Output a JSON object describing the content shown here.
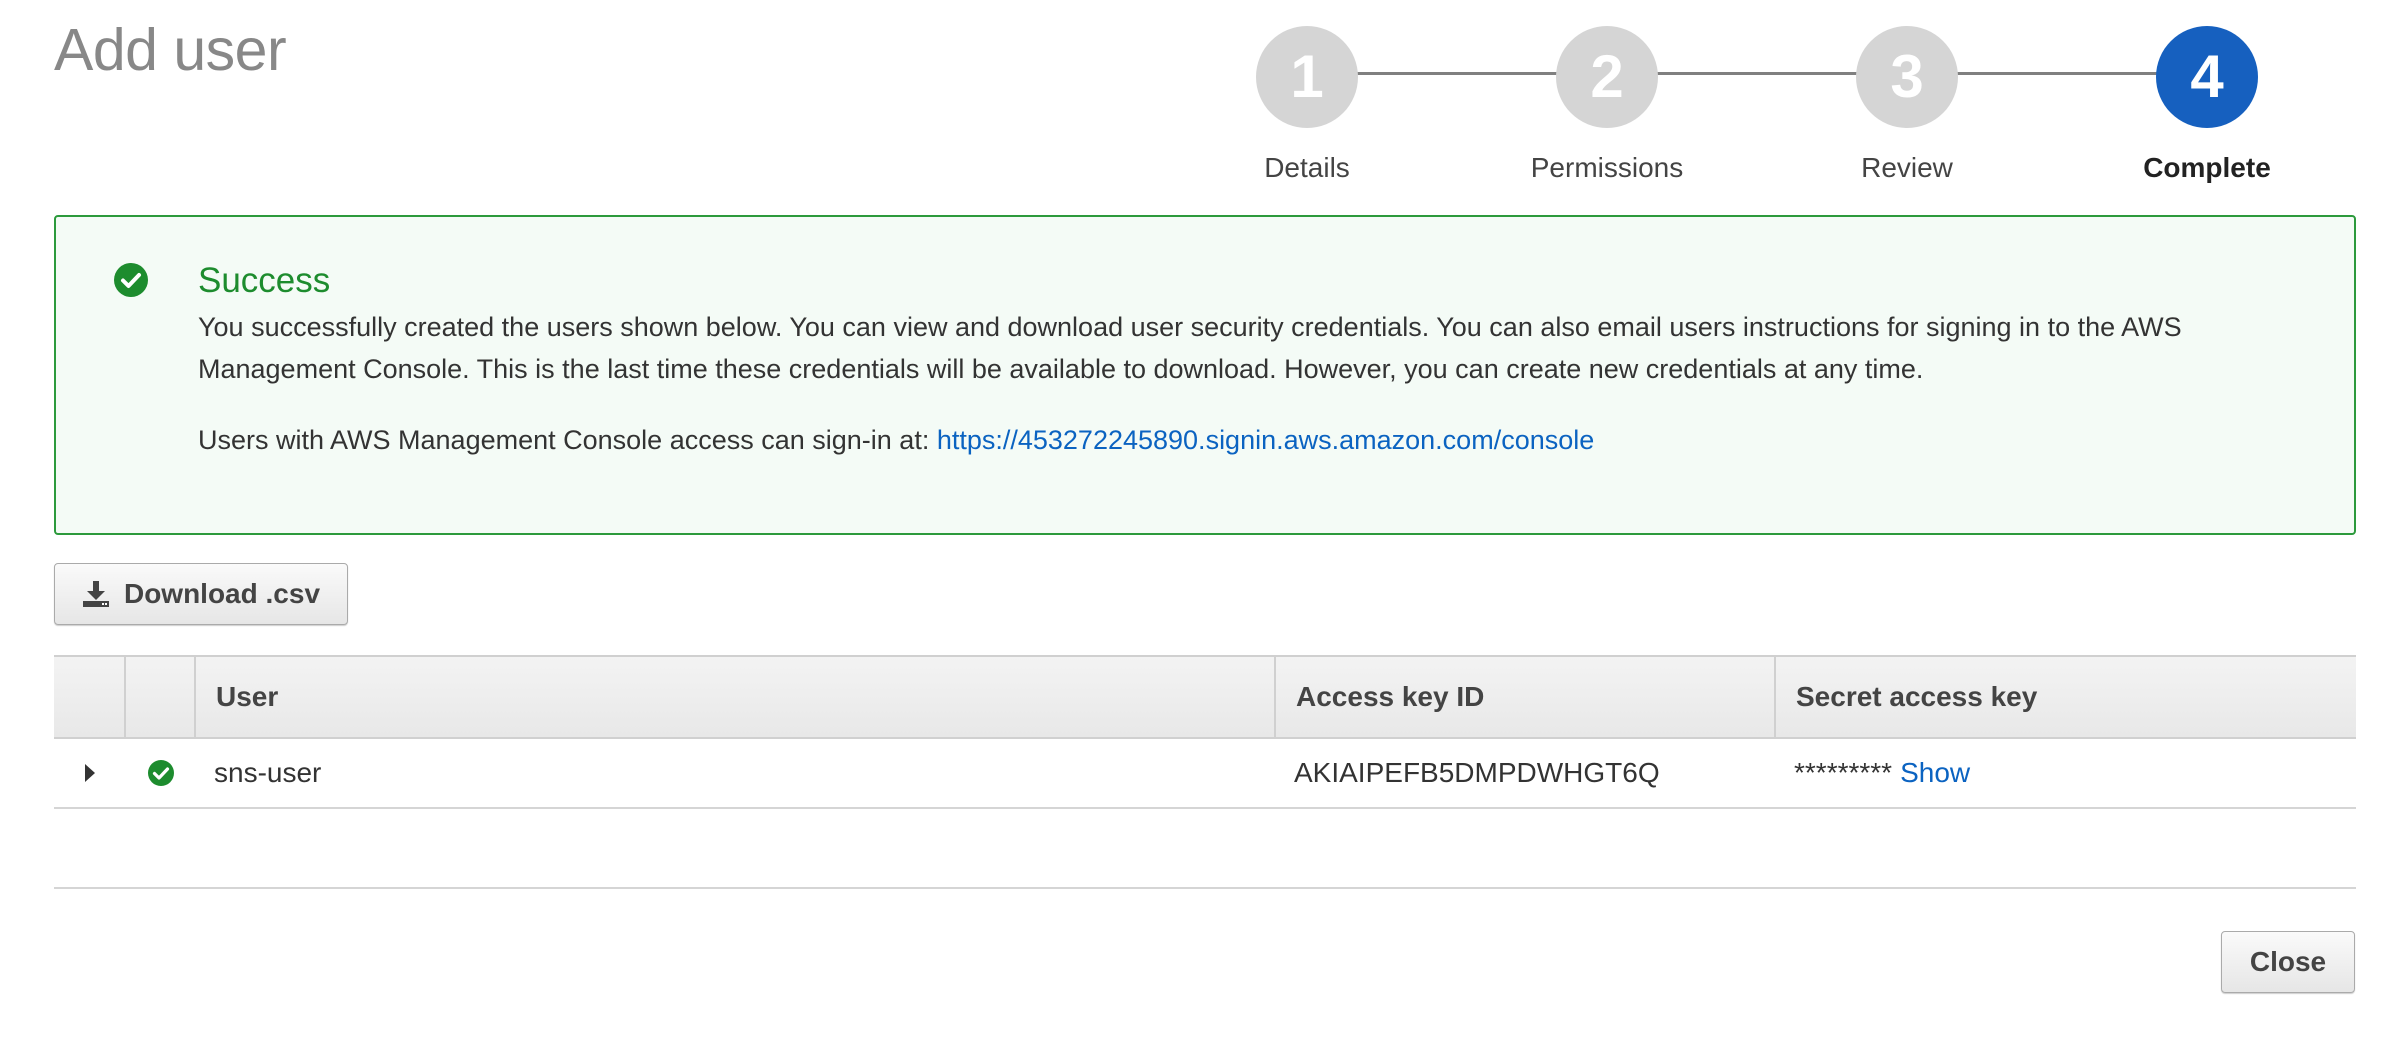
{
  "page": {
    "title": "Add user"
  },
  "stepper": {
    "steps": [
      {
        "number": "1",
        "label": "Details",
        "state": "done"
      },
      {
        "number": "2",
        "label": "Permissions",
        "state": "done"
      },
      {
        "number": "3",
        "label": "Review",
        "state": "done"
      },
      {
        "number": "4",
        "label": "Complete",
        "state": "active"
      }
    ],
    "colors": {
      "inactive": "#d5d5d5",
      "active": "#1660bf",
      "line": "#808080"
    }
  },
  "alert": {
    "icon": "check-circle-icon",
    "title": "Success",
    "message": "You successfully created the users shown below. You can view and download user security credentials. You can also email users instructions for signing in to the AWS Management Console. This is the last time these credentials will be available to download. However, you can create new credentials at any time.",
    "signin_prefix": "Users with AWS Management Console access can sign-in at: ",
    "signin_link": "https://453272245890.signin.aws.amazon.com/console",
    "colors": {
      "border": "#2c9a3c",
      "background": "#f4fbf6",
      "title": "#1d8c2e"
    }
  },
  "actions": {
    "download_label": "Download .csv",
    "download_icon": "download-icon",
    "close_label": "Close"
  },
  "table": {
    "headers": [
      "",
      "",
      "User",
      "Access key ID",
      "Secret access key"
    ],
    "rows": [
      {
        "expand_icon": "caret-right-icon",
        "status_icon": "check-circle-icon",
        "user": "sns-user",
        "access_key_id": "AKIAIPEFB5DMPDWHGT6Q",
        "secret_mask": "*********",
        "secret_action": "Show"
      }
    ]
  },
  "colors": {
    "link": "#0b63c1",
    "success": "#1d8c2e"
  }
}
